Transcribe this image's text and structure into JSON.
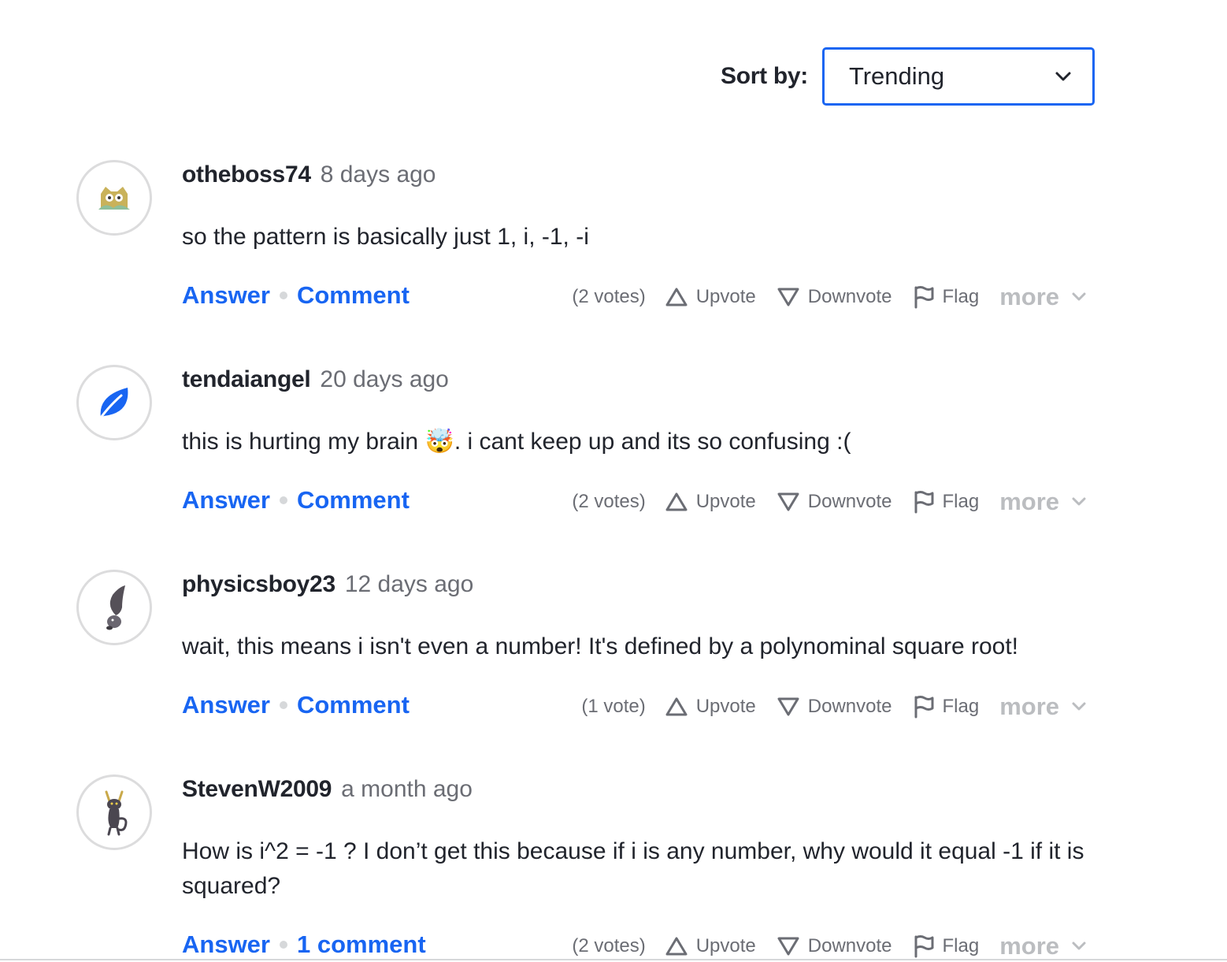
{
  "sort": {
    "label": "Sort by:",
    "selected": "Trending"
  },
  "threads": [
    {
      "avatar": "owl-avatar-icon",
      "username": "otheboss74",
      "time": "8 days ago",
      "text": "so the pattern is basically just 1, i, -1, -i",
      "answer_label": "Answer",
      "comment_label": "Comment",
      "votes": "(2 votes)"
    },
    {
      "avatar": "leaf-avatar-icon",
      "username": "tendaiangel",
      "time": "20 days ago",
      "text_before": "this is hurting my brain ",
      "emoji": "🤯",
      "text_after": ". i cant keep up and its so confusing :(",
      "answer_label": "Answer",
      "comment_label": "Comment",
      "votes": "(2 votes)"
    },
    {
      "avatar": "pokemon-avatar-icon",
      "username": "physicsboy23",
      "time": "12 days ago",
      "text": "wait, this means i isn't even a number! It's defined by a polynominal square root!",
      "answer_label": "Answer",
      "comment_label": "Comment",
      "votes": "(1 vote)"
    },
    {
      "avatar": "imp-avatar-icon",
      "username": "StevenW2009",
      "time": "a month ago",
      "text": "How is i^2 = -1 ? I don’t get this because if i is any number, why would it equal -1 if it is squared?",
      "answer_label": "Answer",
      "comment_label": "1 comment",
      "votes": "(2 votes)"
    }
  ],
  "actions": {
    "upvote": "Upvote",
    "downvote": "Downvote",
    "flag": "Flag",
    "more": "more"
  },
  "colors": {
    "accent": "#1865f2",
    "text": "#21242c",
    "muted": "#6b6d74",
    "more": "#bbbdc0"
  }
}
